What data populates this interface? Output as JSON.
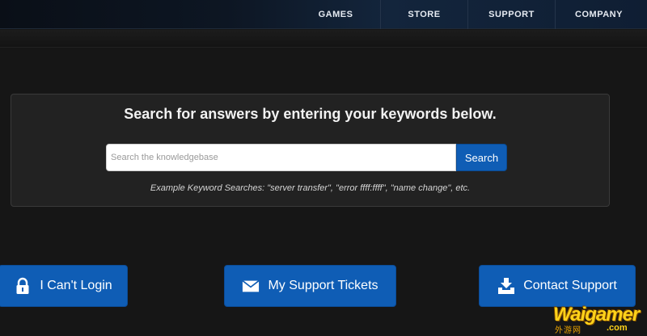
{
  "nav": {
    "items": [
      {
        "label": "GAMES"
      },
      {
        "label": "STORE"
      },
      {
        "label": "SUPPORT"
      },
      {
        "label": "COMPANY"
      }
    ]
  },
  "search": {
    "heading": "Search for answers by entering your keywords below.",
    "placeholder": "Search the knowledgebase",
    "button_label": "Search",
    "example": "Example Keyword Searches: \"server transfer\", \"error ffff:ffff\", \"name change\", etc."
  },
  "actions": {
    "login_label": "I Can't Login",
    "tickets_label": "My Support Tickets",
    "contact_label": "Contact Support"
  },
  "watermark": {
    "brand": "Waigamer",
    "sub": "外游网",
    "domain": ".com"
  },
  "colors": {
    "accent": "#0f5db5",
    "background": "#161616",
    "panel": "#222222"
  },
  "icons": {
    "login": "padlock-icon",
    "tickets": "envelope-icon",
    "contact": "download-tray-icon"
  }
}
